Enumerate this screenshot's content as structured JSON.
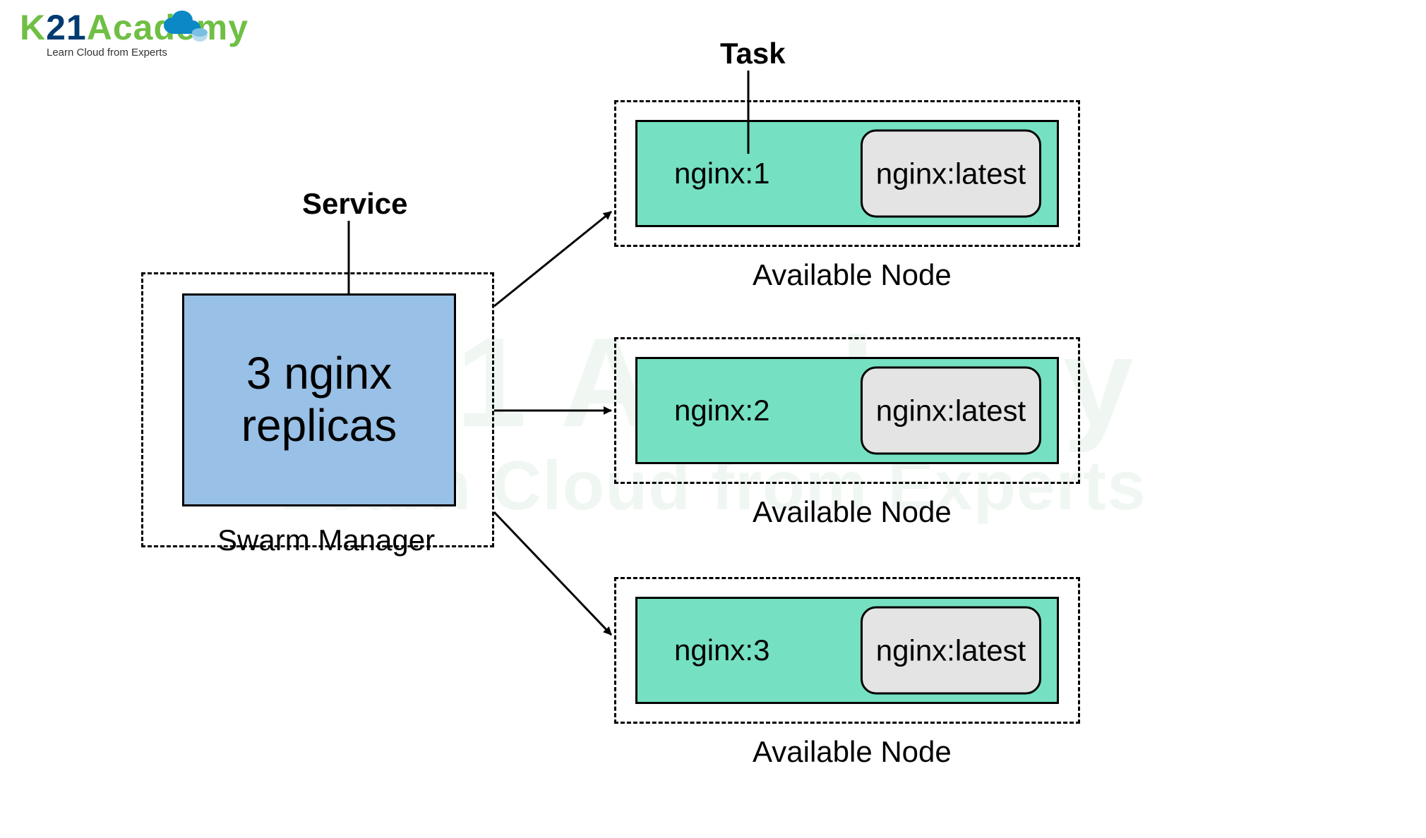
{
  "logo": {
    "text_k": "K",
    "text_21": "21",
    "text_academy": "Academy",
    "tagline": "Learn Cloud from Experts"
  },
  "watermark": {
    "line1": "K21 Academy",
    "line2": "Learn Cloud from Experts"
  },
  "labels": {
    "service": "Service",
    "task": "Task",
    "swarm_manager": "Swarm Manager",
    "available_node": "Available Node"
  },
  "service_box": {
    "text": "3 nginx\nreplicas"
  },
  "nodes": [
    {
      "task": "nginx:1",
      "image": "nginx:latest"
    },
    {
      "task": "nginx:2",
      "image": "nginx:latest"
    },
    {
      "task": "nginx:3",
      "image": "nginx:latest"
    }
  ]
}
